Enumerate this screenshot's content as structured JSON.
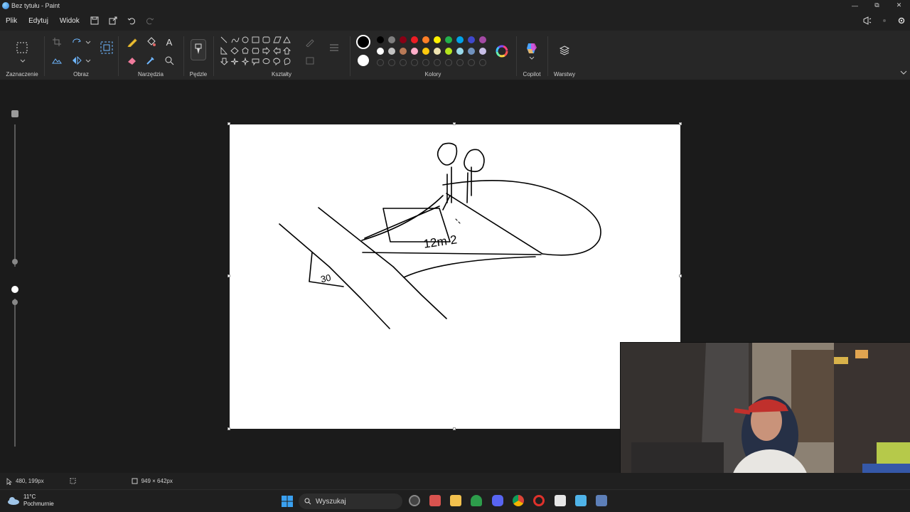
{
  "window": {
    "title": "Bez tytułu - Paint"
  },
  "menu": {
    "file": "Plik",
    "edit": "Edytuj",
    "view": "Widok"
  },
  "ribbon": {
    "groups": {
      "selection": "Zaznaczenie",
      "image": "Obraz",
      "tools": "Narzędzia",
      "brushes": "Pędzle",
      "shapes": "Kształty",
      "colors": "Kolory",
      "copilot": "Copilot",
      "layers": "Warstwy"
    },
    "palette_row1": [
      "#000000",
      "#7f7f7f",
      "#880015",
      "#ed1c24",
      "#ff7f27",
      "#fff200",
      "#22b14c",
      "#00a2e8",
      "#3f48cc",
      "#a349a4"
    ],
    "palette_row2": [
      "#ffffff",
      "#c3c3c3",
      "#b97a57",
      "#ffaec9",
      "#ffc90e",
      "#efe4b0",
      "#b5e61d",
      "#99d9ea",
      "#7092be",
      "#c8bfe7"
    ],
    "primary_color": "#000000",
    "secondary_color": "#ffffff"
  },
  "drawing": {
    "label_area": "12m 2",
    "label_angle": "30"
  },
  "status": {
    "cursor_pos": "480, 199px",
    "canvas_size": "949 × 642px"
  },
  "taskbar": {
    "temperature": "11°C",
    "weather": "Pochmurnie",
    "search_placeholder": "Wyszukaj"
  }
}
